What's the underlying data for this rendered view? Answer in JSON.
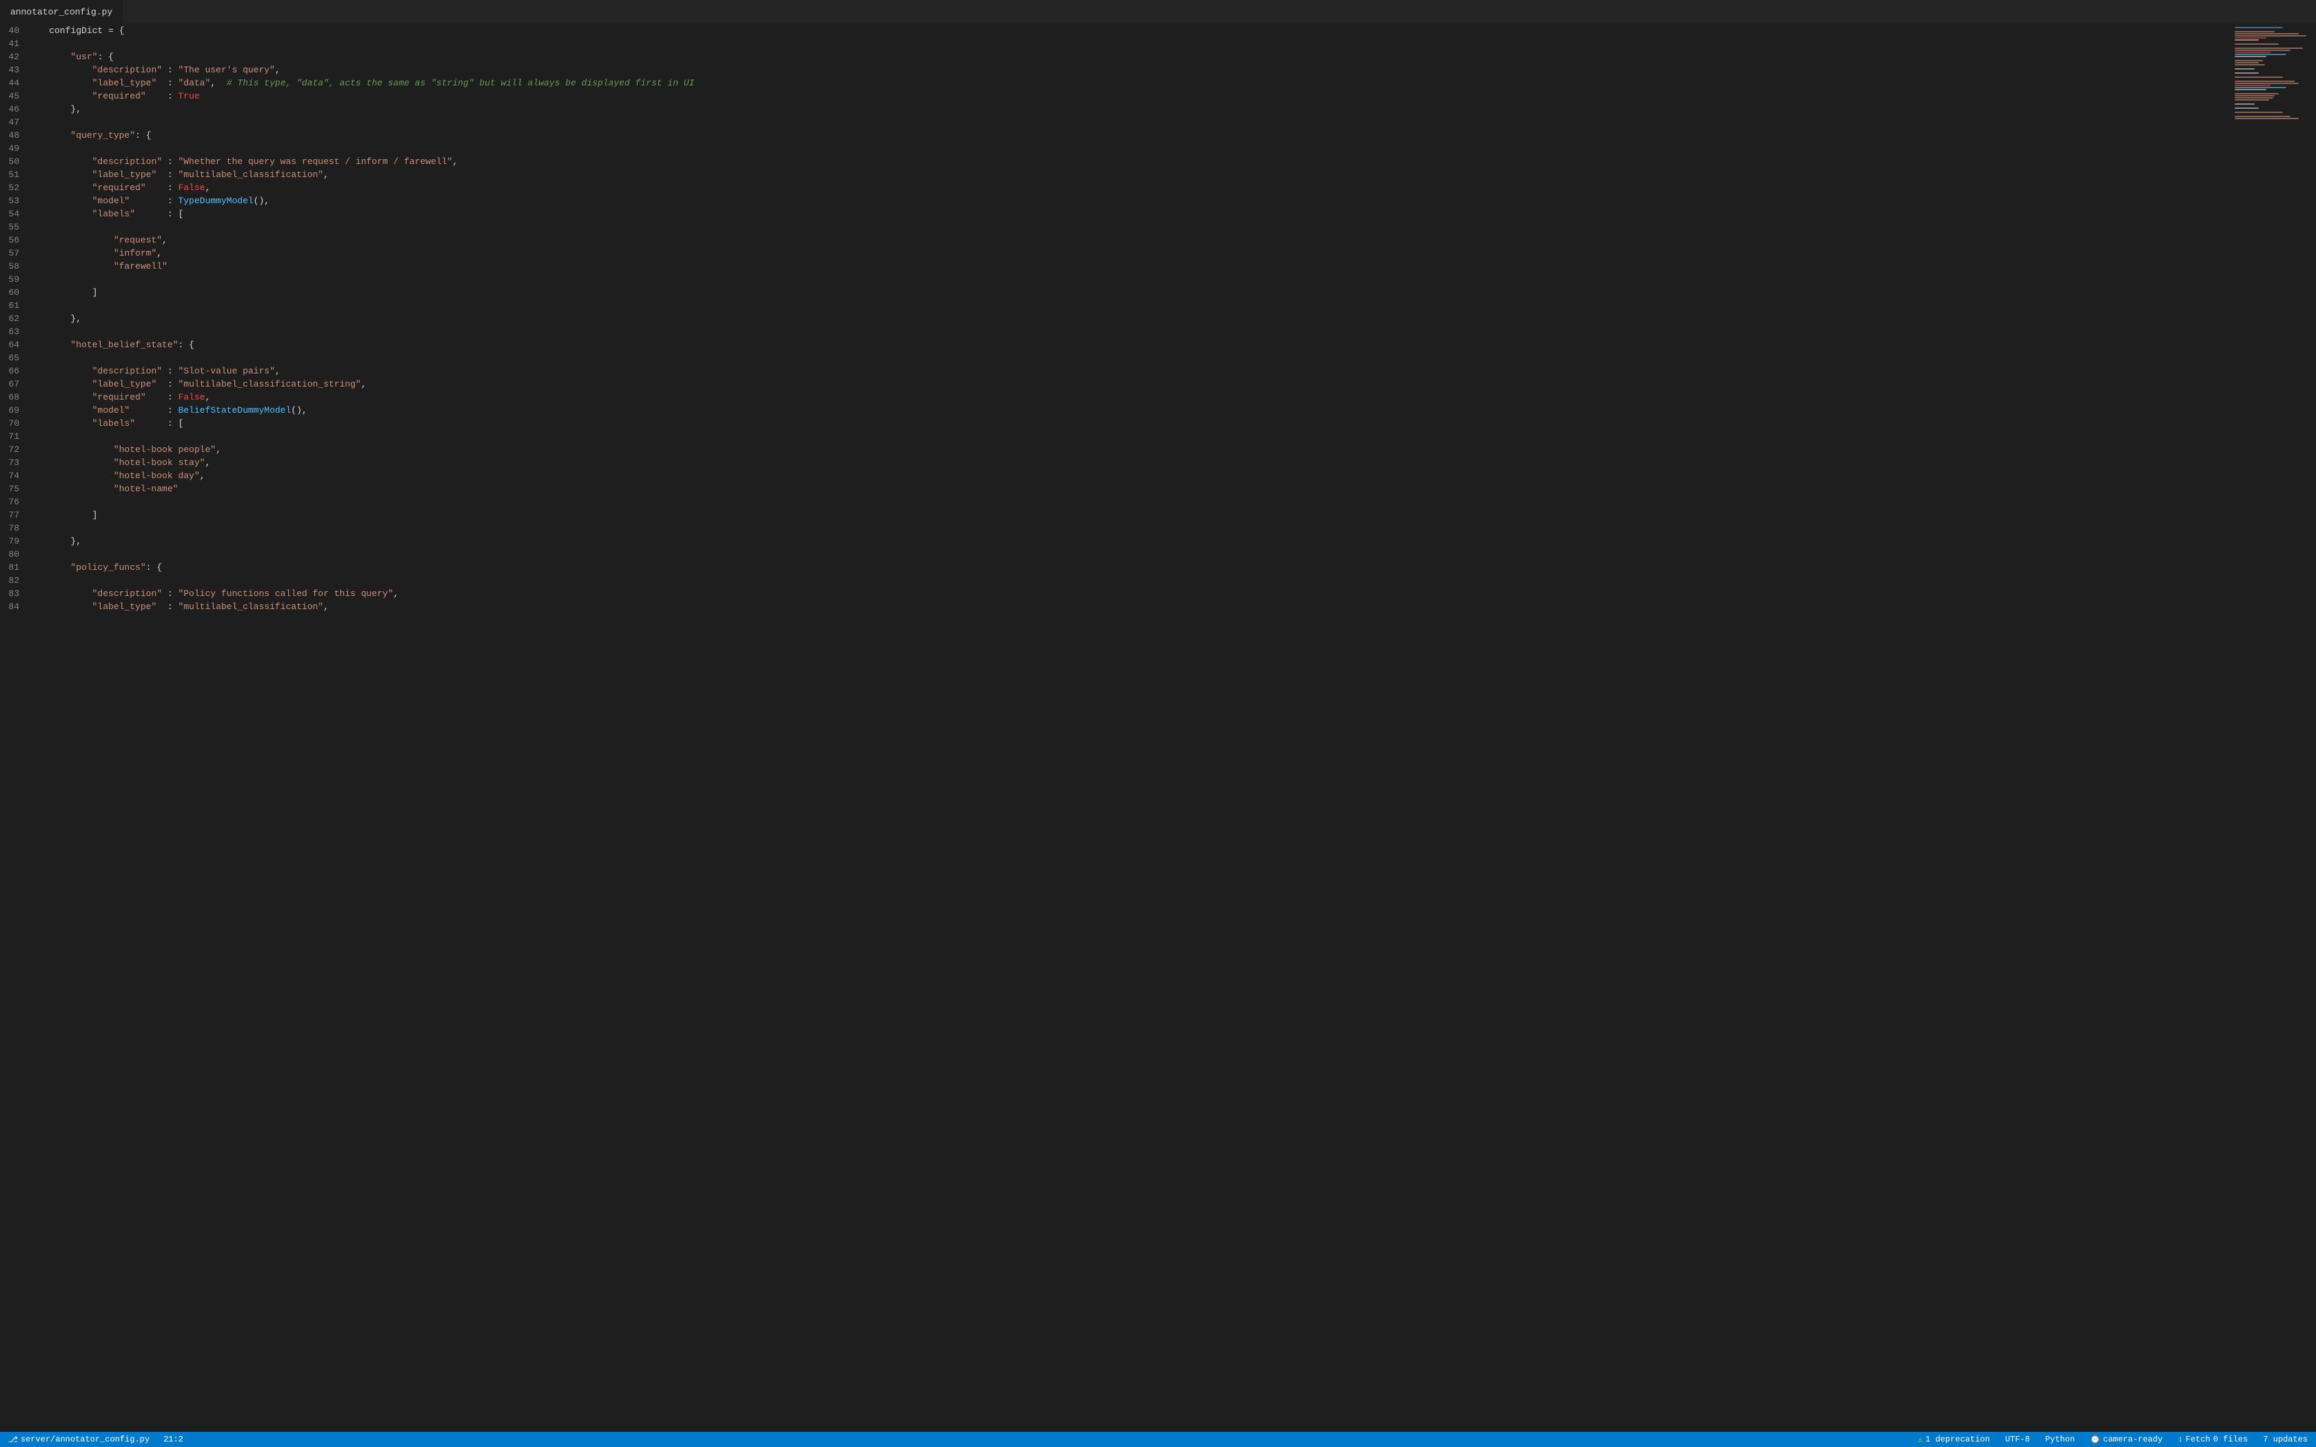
{
  "tab": {
    "filename": "annotator_config.py"
  },
  "status": {
    "left": {
      "git_branch": "server/annotator_config.py",
      "position": "21:2"
    },
    "right": {
      "warning_label": "1 deprecation",
      "encoding": "UTF-8",
      "language": "Python",
      "camera_ready": "camera-ready",
      "fetch": "Fetch",
      "files": "0 files",
      "updates": "7 updates"
    }
  },
  "lines": [
    {
      "num": "40",
      "content": "    configDict = {"
    },
    {
      "num": "41",
      "content": ""
    },
    {
      "num": "42",
      "content": "        \"usr\": {"
    },
    {
      "num": "43",
      "content": "            \"description\" : \"The user's query\","
    },
    {
      "num": "44",
      "content": "            \"label_type\"  : \"data\",  # This type, \"data\", acts the same as \"string\" but will always be displayed first in UI"
    },
    {
      "num": "45",
      "content": "            \"required\"    : True"
    },
    {
      "num": "46",
      "content": "        },"
    },
    {
      "num": "47",
      "content": ""
    },
    {
      "num": "48",
      "content": "        \"query_type\": {"
    },
    {
      "num": "49",
      "content": ""
    },
    {
      "num": "50",
      "content": "            \"description\" : \"Whether the query was request / inform / farewell\","
    },
    {
      "num": "51",
      "content": "            \"label_type\"  : \"multilabel_classification\","
    },
    {
      "num": "52",
      "content": "            \"required\"    : False,"
    },
    {
      "num": "53",
      "content": "            \"model\"       : TypeDummyModel(),"
    },
    {
      "num": "54",
      "content": "            \"labels\"      : ["
    },
    {
      "num": "55",
      "content": ""
    },
    {
      "num": "56",
      "content": "                \"request\","
    },
    {
      "num": "57",
      "content": "                \"inform\","
    },
    {
      "num": "58",
      "content": "                \"farewell\""
    },
    {
      "num": "59",
      "content": ""
    },
    {
      "num": "60",
      "content": "            ]"
    },
    {
      "num": "61",
      "content": ""
    },
    {
      "num": "62",
      "content": "        },"
    },
    {
      "num": "63",
      "content": ""
    },
    {
      "num": "64",
      "content": "        \"hotel_belief_state\": {"
    },
    {
      "num": "65",
      "content": ""
    },
    {
      "num": "66",
      "content": "            \"description\" : \"Slot-value pairs\","
    },
    {
      "num": "67",
      "content": "            \"label_type\"  : \"multilabel_classification_string\","
    },
    {
      "num": "68",
      "content": "            \"required\"    : False,"
    },
    {
      "num": "69",
      "content": "            \"model\"       : BeliefStateDummyModel(),"
    },
    {
      "num": "70",
      "content": "            \"labels\"      : ["
    },
    {
      "num": "71",
      "content": ""
    },
    {
      "num": "72",
      "content": "                \"hotel-book people\","
    },
    {
      "num": "73",
      "content": "                \"hotel-book stay\","
    },
    {
      "num": "74",
      "content": "                \"hotel-book day\","
    },
    {
      "num": "75",
      "content": "                \"hotel-name\""
    },
    {
      "num": "76",
      "content": ""
    },
    {
      "num": "77",
      "content": "            ]"
    },
    {
      "num": "78",
      "content": ""
    },
    {
      "num": "79",
      "content": "        },"
    },
    {
      "num": "80",
      "content": ""
    },
    {
      "num": "81",
      "content": "        \"policy_funcs\": {"
    },
    {
      "num": "82",
      "content": ""
    },
    {
      "num": "83",
      "content": "            \"description\" : \"Policy functions called for this query\","
    },
    {
      "num": "84",
      "content": "            \"label_type\"  : \"multilabel_classification\","
    }
  ]
}
